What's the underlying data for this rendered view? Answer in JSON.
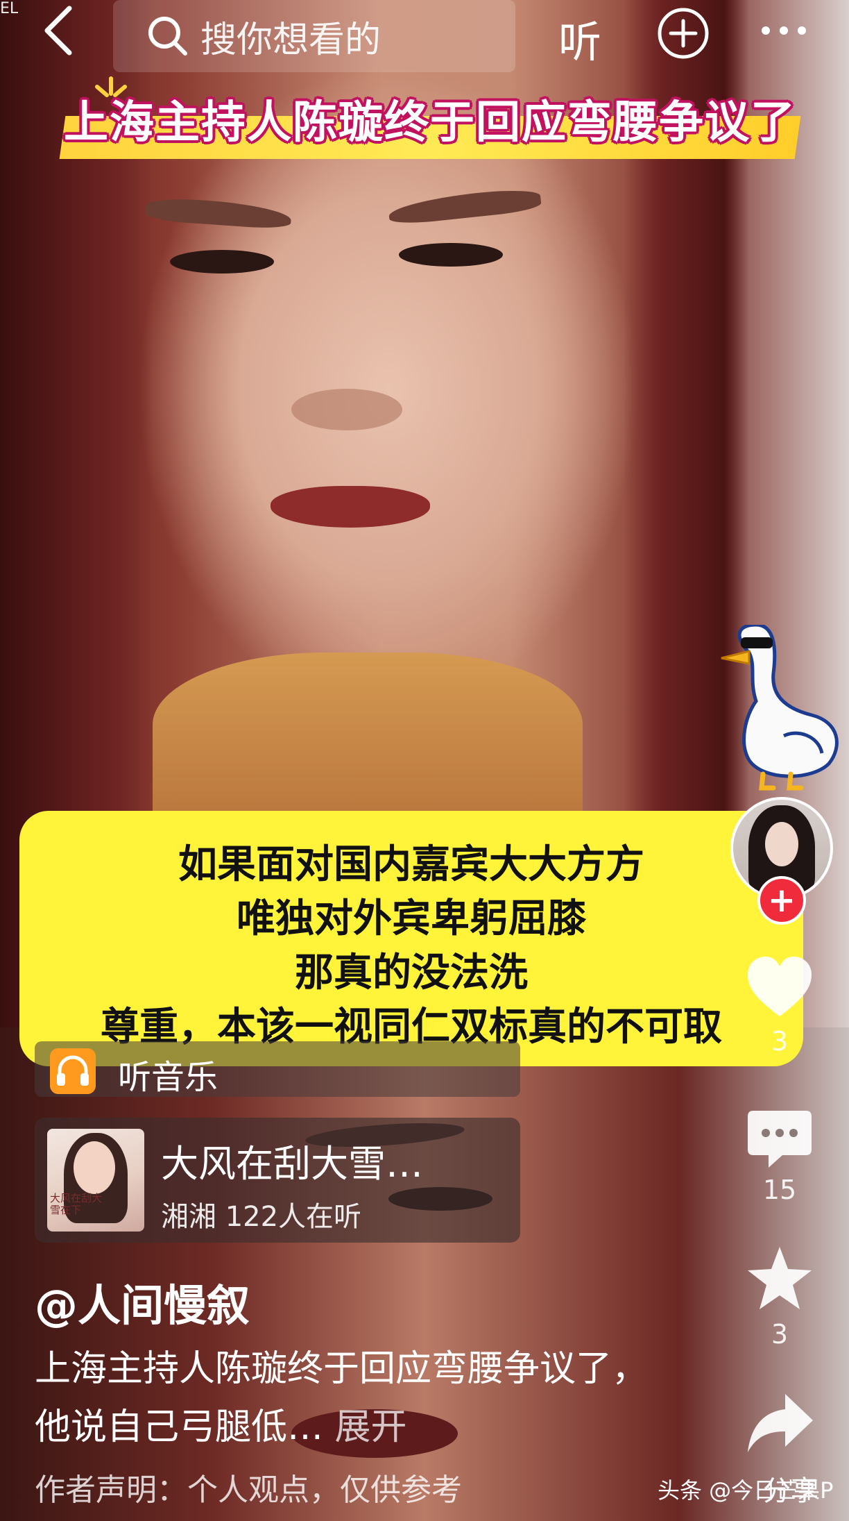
{
  "topbar": {
    "corner_mark": "EL",
    "search_placeholder": "搜你想看的",
    "listen_label": "听"
  },
  "headline": "上海主持人陈璇终于回应弯腰争议了",
  "quote": {
    "lines": [
      "如果面对国内嘉宾大大方方",
      "唯独对外宾卑躬屈膝",
      "那真的没法洗",
      "尊重，本该一视同仁双标真的不可取"
    ]
  },
  "music": {
    "label": "听音乐",
    "song_title": "大风在刮大雪…",
    "song_meta": "湘湘 122人在听",
    "cover_text": "大风在刮大\n雪在下"
  },
  "post": {
    "author": "@人间慢叙",
    "caption": "上海主持人陈璇终于回应弯腰争议了，他说自己弓腿低…",
    "expand": "展开",
    "disclaimer": "作者声明：个人观点，仅供参考"
  },
  "rail": {
    "like_count": "3",
    "comment_count": "15",
    "favorite_count": "3",
    "share_label": "分享"
  },
  "watermark": "头条 @今日芒果P",
  "colors": {
    "quote_bg": "#fff43a",
    "headline_outline": "#c0125e",
    "follow_red": "#f02c3c",
    "music_orange": "#ff9a1e"
  },
  "icons": [
    "back-icon",
    "search-icon",
    "plus-circle-icon",
    "more-icon",
    "headphone-icon",
    "heart-icon",
    "comment-icon",
    "star-icon",
    "share-icon",
    "goose-sticker-icon"
  ]
}
